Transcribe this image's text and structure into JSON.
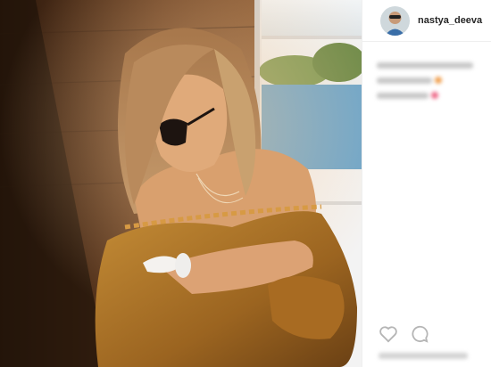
{
  "post": {
    "author": {
      "username": "nastya_deeva",
      "avatar_icon": "profile-avatar"
    },
    "photo": {
      "description_icon": "post-photo"
    },
    "comments_blurred": [
      {
        "accent": "#c8c8c8"
      },
      {
        "accent": "#f0a050"
      },
      {
        "accent": "#ee6b8a"
      }
    ],
    "actions": [
      {
        "icon": "heart-icon"
      },
      {
        "icon": "comment-icon"
      }
    ],
    "colors": {
      "text": "#262626",
      "divider": "#efefef",
      "wood": "#5a3518",
      "dress": "#b07a2a"
    }
  }
}
